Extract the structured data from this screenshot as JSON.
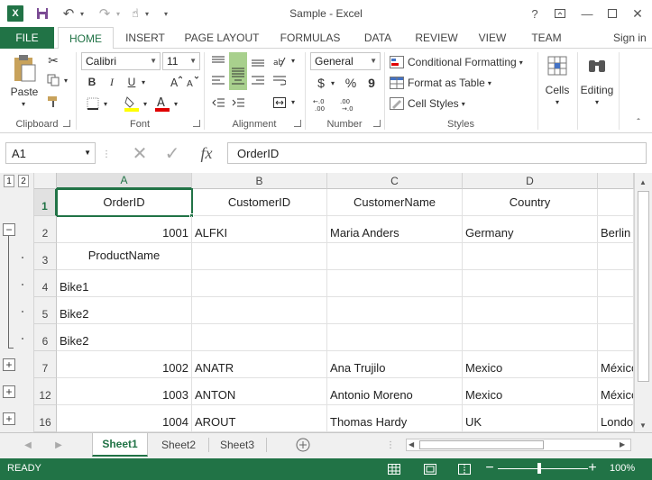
{
  "window": {
    "title": "Sample - Excel",
    "help": "?",
    "signin": "Sign in"
  },
  "tabs": [
    "FILE",
    "HOME",
    "INSERT",
    "PAGE LAYOUT",
    "FORMULAS",
    "DATA",
    "REVIEW",
    "VIEW",
    "TEAM"
  ],
  "ribbon": {
    "clipboard": {
      "paste": "Paste",
      "label": "Clipboard"
    },
    "font": {
      "name": "Calibri",
      "size": "11",
      "bold": "B",
      "italic": "I",
      "underline": "U",
      "label": "Font"
    },
    "alignment": {
      "label": "Alignment"
    },
    "number": {
      "format": "General",
      "currency": "$",
      "percent": "%",
      "comma": "9",
      "label": "Number"
    },
    "styles": {
      "conditional": "Conditional Formatting",
      "table": "Format as Table",
      "cell_styles": "Cell Styles",
      "label": "Styles"
    },
    "cells": "Cells",
    "editing": "Editing"
  },
  "formula": {
    "name_box": "A1",
    "fx": "fx",
    "content": "OrderID"
  },
  "grid": {
    "columns": [
      "A",
      "B",
      "C",
      "D"
    ],
    "level_buttons": [
      "1",
      "2"
    ],
    "rows": [
      {
        "num": "1",
        "cells": [
          "OrderID",
          "CustomerID",
          "CustomerName",
          "Country",
          ""
        ]
      },
      {
        "num": "2",
        "cells": [
          "1001",
          "ALFKI",
          "Maria Anders",
          "Germany",
          "Berlin"
        ]
      },
      {
        "num": "3",
        "cells": [
          "ProductName",
          "",
          "",
          "",
          ""
        ]
      },
      {
        "num": "4",
        "cells": [
          "Bike1",
          "",
          "",
          "",
          ""
        ]
      },
      {
        "num": "5",
        "cells": [
          "Bike2",
          "",
          "",
          "",
          ""
        ]
      },
      {
        "num": "6",
        "cells": [
          "Bike2",
          "",
          "",
          "",
          ""
        ]
      },
      {
        "num": "7",
        "cells": [
          "1002",
          "ANATR",
          "Ana Trujilo",
          "Mexico",
          "México"
        ]
      },
      {
        "num": "12",
        "cells": [
          "1003",
          "ANTON",
          "Antonio Moreno",
          "Mexico",
          "México"
        ]
      },
      {
        "num": "16",
        "cells": [
          "1004",
          "AROUT",
          "Thomas Hardy",
          "UK",
          "London"
        ]
      }
    ]
  },
  "sheets": [
    "Sheet1",
    "Sheet2",
    "Sheet3"
  ],
  "status": {
    "ready": "READY",
    "zoom": "100%"
  },
  "colors": {
    "accent": "#217346"
  }
}
